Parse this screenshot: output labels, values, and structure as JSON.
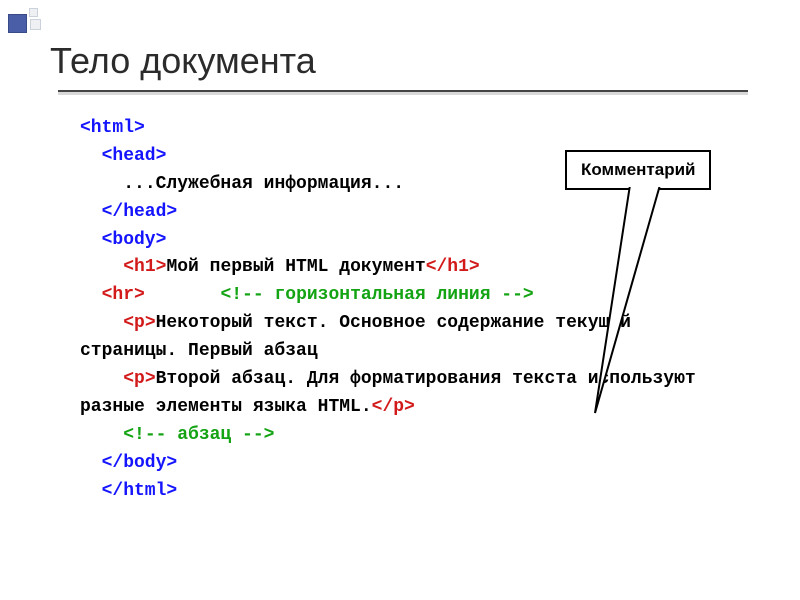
{
  "slide": {
    "title": "Тело документа"
  },
  "callout": {
    "label": "Комментарий"
  },
  "code": {
    "l01": "<html>",
    "l02": "",
    "l03": "  <head>",
    "l04_pre": "    ",
    "l04_txt": "...Служебная информация...",
    "l05": "  </head>",
    "l06": "",
    "l07": "  <body>",
    "l08_pre": "    ",
    "l08_open": "<h1>",
    "l08_txt": "Мой первый HTML документ",
    "l08_close": "</h1>",
    "l09_pre": "  ",
    "l09_tag": "<hr>",
    "l09_sp": "       ",
    "l09_cmt": "<!-- горизонтальная линия -->",
    "l10_pre": "    ",
    "l10_open": "<p>",
    "l10_txt": "Некоторый текст. Основное содержание текущей страницы. Первый абзац",
    "l11_pre": "    ",
    "l11_open": "<p>",
    "l11_txt": "Второй абзац. Для форматирования текста используют разные элементы языка HTML.",
    "l11_close": "</p>",
    "l12_pre": "    ",
    "l12_cmt": "<!-- абзац -->",
    "l13": "  </body>",
    "l14": "",
    "l15": "  </html>"
  }
}
